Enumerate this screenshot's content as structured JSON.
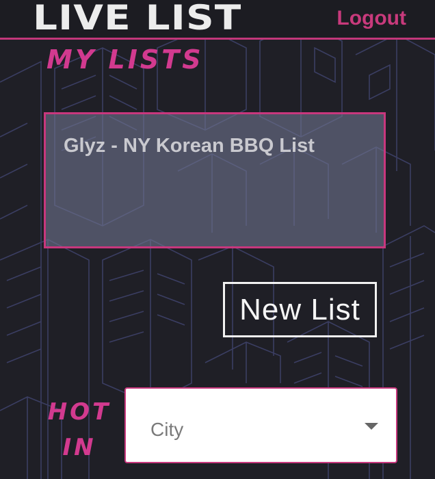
{
  "header": {
    "logo_text": "LIVE LIST",
    "logout_label": "Logout"
  },
  "my_lists": {
    "title": "MY LISTS",
    "items": [
      {
        "label": "Glyz - NY Korean BBQ List"
      }
    ],
    "new_list_label": "New List"
  },
  "hot_in": {
    "title_line1": "HOT",
    "title_line2": "IN",
    "city_select": {
      "value": "City"
    }
  },
  "colors": {
    "accent": "#c8377d",
    "background": "#1f1f26",
    "card_fill": "#6e738c",
    "text_light": "#f5f5f5"
  },
  "icons": {
    "select_caret": "chevron-down-icon",
    "background": "isometric-city-illustration"
  }
}
